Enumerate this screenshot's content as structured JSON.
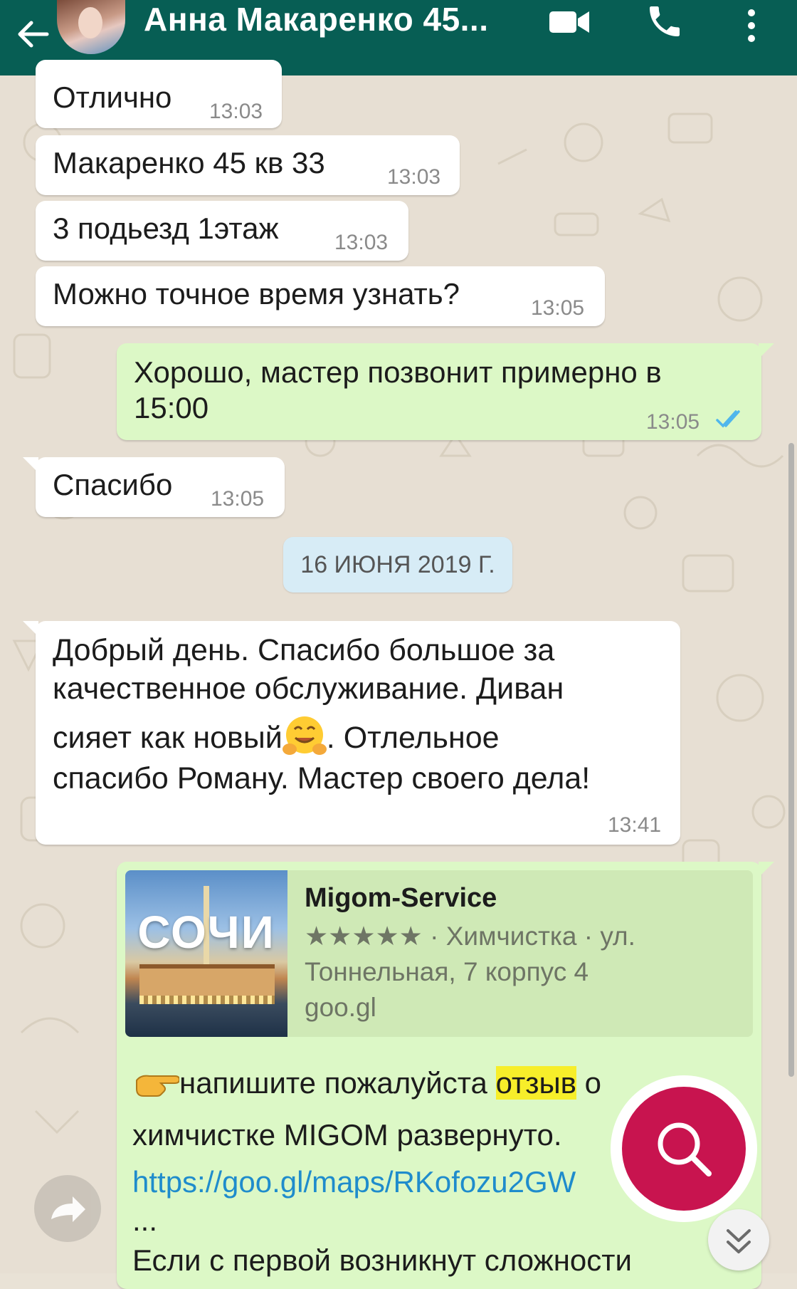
{
  "header": {
    "contact_name": "Анна Макаренко 45...",
    "icons": [
      "back-arrow-icon",
      "video-call-icon",
      "phone-icon",
      "more-vertical-icon"
    ]
  },
  "messages": [
    {
      "text": "Отлично",
      "time": "13:03",
      "direction": "incoming"
    },
    {
      "text": "Макаренко 45 кв 33",
      "time": "13:03",
      "direction": "incoming"
    },
    {
      "text": "3 подьезд 1этаж",
      "time": "13:03",
      "direction": "incoming"
    },
    {
      "text": "Можно точное время узнать?",
      "time": "13:05",
      "direction": "incoming"
    },
    {
      "text_line1": "Хорошо, мастер позвонит примерно в",
      "text_line2": "15:00",
      "time": "13:05",
      "direction": "outgoing",
      "status": "read"
    },
    {
      "text": "Спасибо",
      "time": "13:05",
      "direction": "incoming"
    }
  ],
  "date_divider": "16 ИЮНЯ 2019 Г.",
  "review_message": {
    "line1": "Добрый день. Спасибо большое за",
    "line2": "качественное обслуживание. Диван",
    "line3_before": "сияет как новый",
    "line3_after": ". Отлельное",
    "line4": "спасибо Роману. Мастер своего дела!",
    "time": "13:41",
    "emoji": "hugging-face-emoji"
  },
  "outgoing_card": {
    "preview": {
      "image_text": "СОЧИ",
      "title": "Migom-Service",
      "stars": "★★★★★",
      "desc_line1_after_stars": " · Химчистка · ул.",
      "desc_line2": "Тоннельная, 7 корпус 4",
      "domain": "goo.gl"
    },
    "line1_before": "напишите пожалуйста ",
    "line1_highlight": "отзыв",
    "line1_after": " о",
    "line2": "химчистке MIGOM развернуто.",
    "link": "https://goo.gl/maps/RKofozu2GW",
    "ellipsis": "...",
    "line_last": "Если с первой возникнут сложности"
  },
  "colors": {
    "header_bg": "#075e54",
    "outgoing_bubble": "#dcf8c6",
    "incoming_bubble": "#ffffff",
    "fab": "#c8144f",
    "read_ticks": "#4fb6ec"
  }
}
